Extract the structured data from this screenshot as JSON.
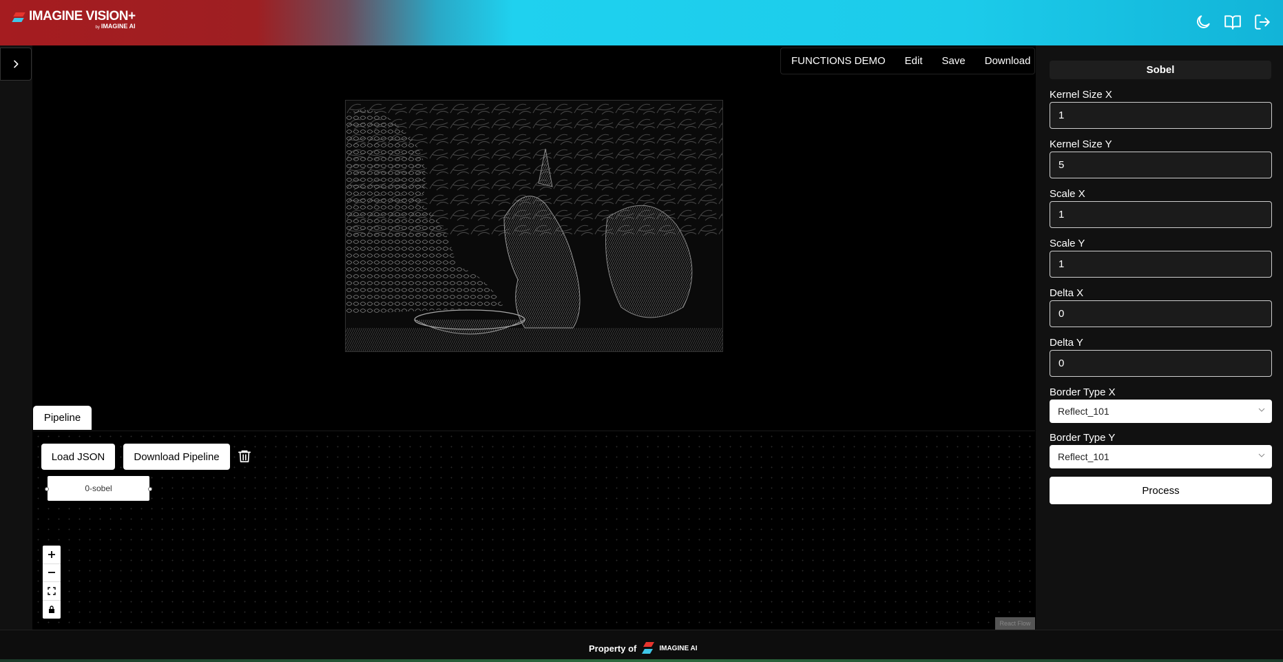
{
  "header": {
    "brand": "IMAGINE VISION+",
    "brand_by": "by",
    "brand_company": "IMAGINE AI",
    "icons": [
      "moon-icon",
      "book-open-icon",
      "logout-icon"
    ]
  },
  "toolbar": {
    "title": "FUNCTIONS DEMO",
    "edit": "Edit",
    "save": "Save",
    "download": "Download"
  },
  "pipeline": {
    "tab_label": "Pipeline",
    "load_json": "Load JSON",
    "download_pipeline": "Download Pipeline",
    "node_label": "0-sobel",
    "attribution": "React Flow"
  },
  "panel": {
    "title": "Sobel",
    "fields": [
      {
        "label": "Kernel Size X",
        "value": "1"
      },
      {
        "label": "Kernel Size Y",
        "value": "5"
      },
      {
        "label": "Scale X",
        "value": "1"
      },
      {
        "label": "Scale Y",
        "value": "1"
      },
      {
        "label": "Delta X",
        "value": "0"
      },
      {
        "label": "Delta Y",
        "value": "0"
      }
    ],
    "selects": [
      {
        "label": "Border Type X",
        "value": "Reflect_101"
      },
      {
        "label": "Border Type Y",
        "value": "Reflect_101"
      }
    ],
    "process": "Process"
  },
  "footer": {
    "text": "Property of",
    "brand": "IMAGINE AI"
  }
}
